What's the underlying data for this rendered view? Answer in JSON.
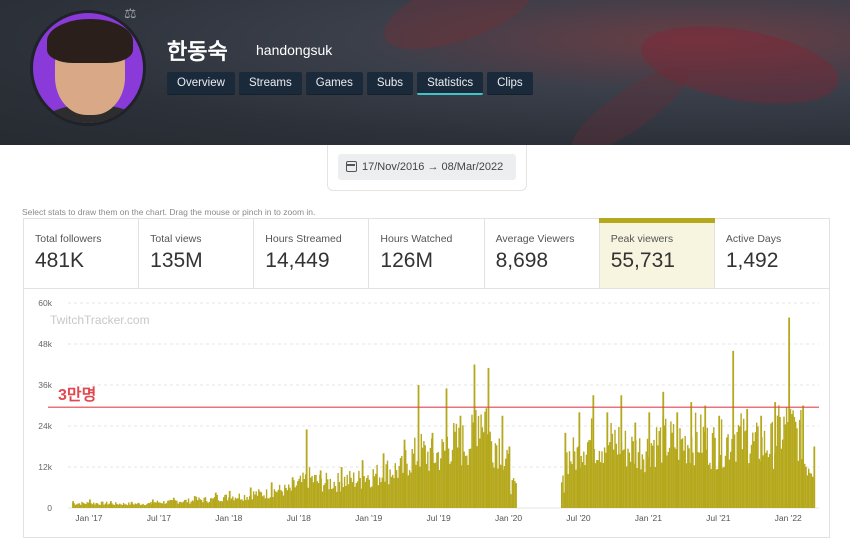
{
  "channel": {
    "display_name": "한동숙",
    "handle": "handongsuk"
  },
  "tabs": [
    {
      "label": "Overview"
    },
    {
      "label": "Streams"
    },
    {
      "label": "Games"
    },
    {
      "label": "Subs"
    },
    {
      "label": "Statistics",
      "active": true
    },
    {
      "label": "Clips"
    }
  ],
  "date_range": {
    "start": "17/Nov/2016",
    "arrow": "→",
    "end": "08/Mar/2022"
  },
  "hint": "Select stats to draw them on the chart. Drag the mouse or pinch in to zoom in.",
  "stats": [
    {
      "label": "Total followers",
      "value": "481K"
    },
    {
      "label": "Total views",
      "value": "135M"
    },
    {
      "label": "Hours Streamed",
      "value": "14,449"
    },
    {
      "label": "Hours Watched",
      "value": "126M"
    },
    {
      "label": "Average Viewers",
      "value": "8,698"
    },
    {
      "label": "Peak viewers",
      "value": "55,731",
      "active": true
    },
    {
      "label": "Active Days",
      "value": "1,492"
    }
  ],
  "colors": {
    "bar": "#b5a81c",
    "threshold": "#e0474f",
    "tab_bg": "#1b2a3a",
    "tab_active_underline": "#40c4c8"
  },
  "chart_data": {
    "type": "bar",
    "watermark": "TwitchTracker.com",
    "ylim": [
      0,
      60000
    ],
    "yticks": [
      "60k",
      "48k",
      "36k",
      "24k",
      "12k",
      "0"
    ],
    "xticks": [
      "Jan '17",
      "Jul '17",
      "Jan '18",
      "Jul '18",
      "Jan '19",
      "Jul '19",
      "Jan '20",
      "Jul '20",
      "Jan '21",
      "Jul '21",
      "Jan '22"
    ],
    "annotation": {
      "text": "3만명",
      "value": 29500
    },
    "series": [
      {
        "values": [
          [
            2016.88,
            2000
          ],
          [
            2017.0,
            2500
          ],
          [
            2017.15,
            2000
          ],
          [
            2017.3,
            1800
          ],
          [
            2017.45,
            2500
          ],
          [
            2017.6,
            3000
          ],
          [
            2017.75,
            3500
          ],
          [
            2017.9,
            4500
          ],
          [
            2018.0,
            5000
          ],
          [
            2018.15,
            6000
          ],
          [
            2018.3,
            7500
          ],
          [
            2018.45,
            9000
          ],
          [
            2018.55,
            23000
          ],
          [
            2018.65,
            11000
          ],
          [
            2018.8,
            12000
          ],
          [
            2018.95,
            14000
          ],
          [
            2019.1,
            16000
          ],
          [
            2019.25,
            20000
          ],
          [
            2019.35,
            36000
          ],
          [
            2019.45,
            22000
          ],
          [
            2019.55,
            35000
          ],
          [
            2019.65,
            27000
          ],
          [
            2019.75,
            42000
          ],
          [
            2019.85,
            41000
          ],
          [
            2019.95,
            27000
          ],
          [
            2020.0,
            18000
          ],
          [
            2020.1,
            8000
          ],
          [
            2020.4,
            22000
          ],
          [
            2020.5,
            28000
          ],
          [
            2020.6,
            33000
          ],
          [
            2020.7,
            28000
          ],
          [
            2020.8,
            33000
          ],
          [
            2020.9,
            25000
          ],
          [
            2021.0,
            28000
          ],
          [
            2021.1,
            34000
          ],
          [
            2021.2,
            28000
          ],
          [
            2021.3,
            31000
          ],
          [
            2021.4,
            30000
          ],
          [
            2021.5,
            27000
          ],
          [
            2021.6,
            46000
          ],
          [
            2021.7,
            29000
          ],
          [
            2021.8,
            27000
          ],
          [
            2021.9,
            31000
          ],
          [
            2022.0,
            55731
          ],
          [
            2022.1,
            30000
          ],
          [
            2022.18,
            18000
          ]
        ]
      }
    ]
  }
}
